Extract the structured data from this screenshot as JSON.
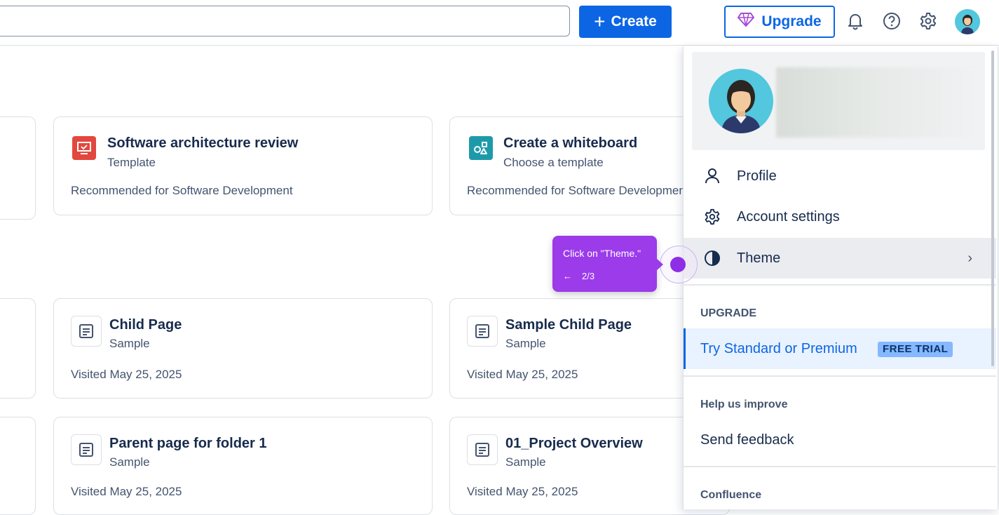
{
  "topbar": {
    "search_placeholder": "",
    "create_label": "Create",
    "upgrade_label": "Upgrade"
  },
  "cards_row1": [
    {
      "title": "Software architecture review",
      "subtitle": "Template",
      "meta": "Recommended for Software Development",
      "icon": "presentation-icon",
      "icon_color": "#e2483d"
    },
    {
      "title": "Create a whiteboard",
      "subtitle": "Choose a template",
      "meta": "Recommended for Software Development",
      "icon": "whiteboard-icon",
      "icon_color": "#1d9aaa"
    }
  ],
  "cards_row2": [
    {
      "title": "Child Page",
      "subtitle": "Sample",
      "meta": "Visited May 25, 2025"
    },
    {
      "title": "Sample Child Page",
      "subtitle": "Sample",
      "meta": "Visited May 25, 2025"
    }
  ],
  "cards_row3": [
    {
      "title": "Parent page for folder 1",
      "subtitle": "Sample",
      "meta": "Visited May 25, 2025"
    },
    {
      "title": "01_Project Overview",
      "subtitle": "Sample",
      "meta": "Visited May 25, 2025"
    }
  ],
  "tooltip": {
    "text": "Click on \"Theme.\"",
    "back_arrow": "←",
    "step": "2/3"
  },
  "menu": {
    "items": [
      {
        "label": "Profile",
        "icon": "person-icon"
      },
      {
        "label": "Account settings",
        "icon": "gear-icon"
      },
      {
        "label": "Theme",
        "icon": "half-circle-icon",
        "chevron": "›"
      }
    ],
    "upgrade_section": "UPGRADE",
    "trial_label": "Try Standard or Premium",
    "trial_badge": "FREE TRIAL",
    "help_section": "Help us improve",
    "feedback_label": "Send feedback",
    "confluence_section": "Confluence"
  },
  "colors": {
    "primary": "#0c66e4",
    "tooltip": "#9b3bea",
    "hotspot": "#8e2ee6"
  }
}
